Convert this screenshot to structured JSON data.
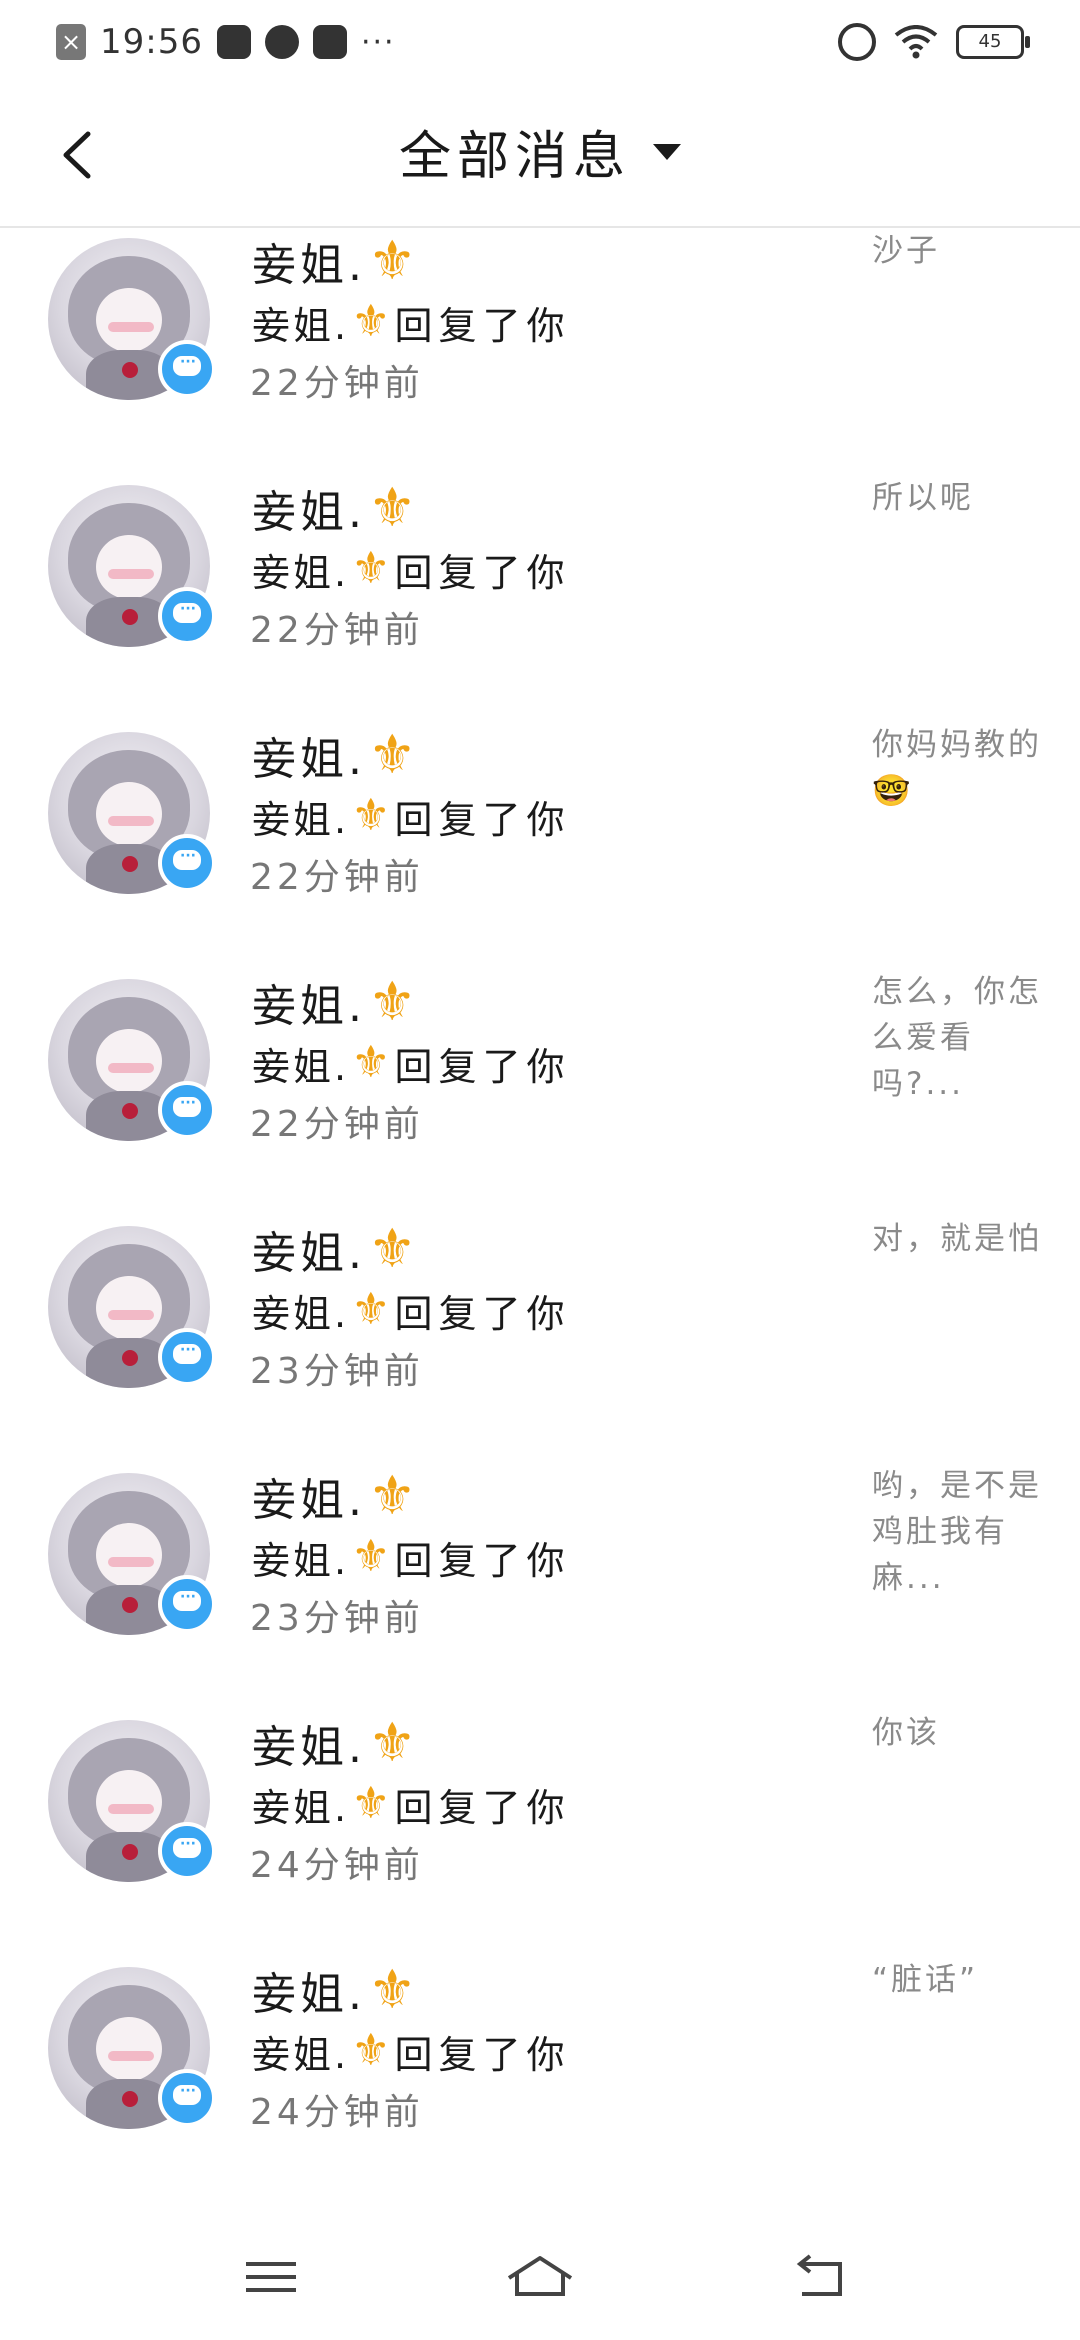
{
  "status_bar": {
    "time": "19:56",
    "battery": "45",
    "icons": [
      "close-notification-icon",
      "card-icon",
      "compass-icon",
      "play-icon",
      "more-dots-icon",
      "alarm-icon",
      "wifi-icon",
      "battery-icon"
    ]
  },
  "header": {
    "title": "全部消息",
    "back_icon": "chevron-left-icon",
    "dropdown_icon": "caret-down-icon"
  },
  "messages": [
    {
      "name": "妾姐.",
      "reply_name": "妾姐.",
      "reply_action": "回复了你",
      "time": "22分钟前",
      "snippet": "沙子"
    },
    {
      "name": "妾姐.",
      "reply_name": "妾姐.",
      "reply_action": "回复了你",
      "time": "22分钟前",
      "snippet": "所以呢"
    },
    {
      "name": "妾姐.",
      "reply_name": "妾姐.",
      "reply_action": "回复了你",
      "time": "22分钟前",
      "snippet": "你妈妈教的🤓"
    },
    {
      "name": "妾姐.",
      "reply_name": "妾姐.",
      "reply_action": "回复了你",
      "time": "22分钟前",
      "snippet": "怎么，你怎么爱看吗?..."
    },
    {
      "name": "妾姐.",
      "reply_name": "妾姐.",
      "reply_action": "回复了你",
      "time": "23分钟前",
      "snippet": "对，就是怕"
    },
    {
      "name": "妾姐.",
      "reply_name": "妾姐.",
      "reply_action": "回复了你",
      "time": "23分钟前",
      "snippet": "哟，是不是鸡肚我有麻..."
    },
    {
      "name": "妾姐.",
      "reply_name": "妾姐.",
      "reply_action": "回复了你",
      "time": "24分钟前",
      "snippet": "你该"
    },
    {
      "name": "妾姐.",
      "reply_name": "妾姐.",
      "reply_action": "回复了你",
      "time": "24分钟前",
      "snippet": "“脏话”"
    }
  ],
  "fleur_symbol": "⚜",
  "colors": {
    "fleur": "#f0a316",
    "badge": "#39a6f3",
    "snippet": "#8a8a8a",
    "time": "#777777"
  },
  "nav": {
    "menu_icon": "menu-icon",
    "home_icon": "home-icon",
    "back_icon": "back-arrow-icon"
  }
}
